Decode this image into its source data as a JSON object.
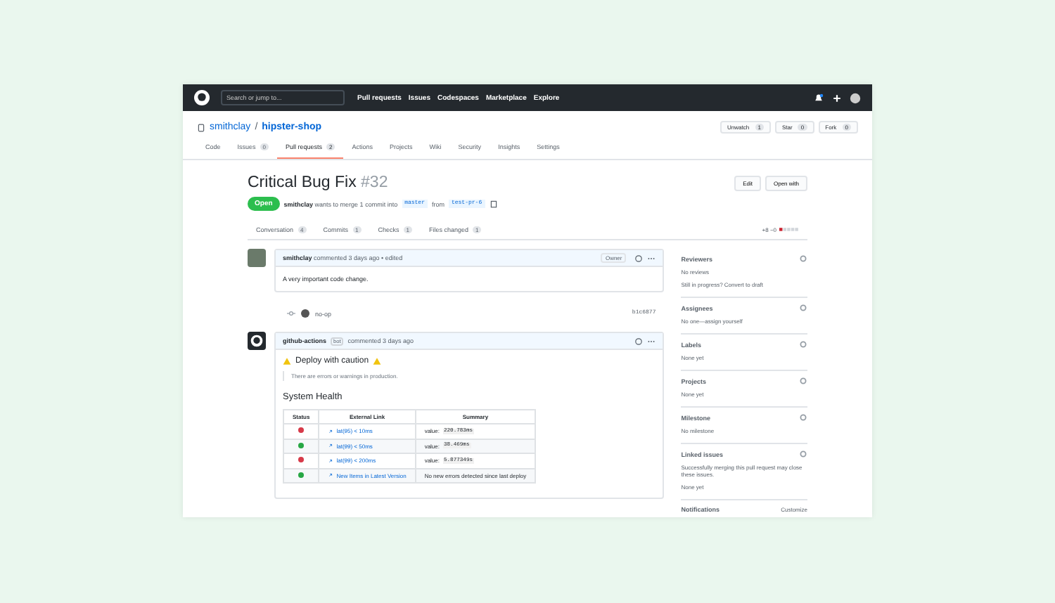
{
  "header": {
    "search": {
      "placeholder": "Search or jump to..."
    },
    "nav": [
      "Pull requests",
      "Issues",
      "Codespaces",
      "Marketplace",
      "Explore"
    ]
  },
  "repo": {
    "owner": "smithclay",
    "separator": "/",
    "name": "hipster-shop",
    "actions": [
      {
        "label": "Unwatch",
        "count": "1"
      },
      {
        "label": "Star",
        "count": "0"
      },
      {
        "label": "Fork",
        "count": "0"
      }
    ]
  },
  "tabs": [
    {
      "label": "Code",
      "selected": false
    },
    {
      "label": "Issues",
      "count": "0",
      "selected": false
    },
    {
      "label": "Pull requests",
      "count": "2",
      "selected": true
    },
    {
      "label": "Actions",
      "selected": false
    },
    {
      "label": "Projects",
      "selected": false
    },
    {
      "label": "Wiki",
      "selected": false
    },
    {
      "label": "Security",
      "selected": false
    },
    {
      "label": "Insights",
      "selected": false
    },
    {
      "label": "Settings",
      "selected": false
    }
  ],
  "pr": {
    "title": "Critical Bug Fix",
    "number": "#32",
    "buttons": [
      "Edit",
      "Open with"
    ],
    "state": "Open",
    "author": "smithclay",
    "merge_text": "wants to merge 1 commit into",
    "base": "master",
    "from": "from",
    "head": "test-pr-6",
    "tabs": [
      {
        "label": "Conversation",
        "count": "4"
      },
      {
        "label": "Commits",
        "count": "1"
      },
      {
        "label": "Checks",
        "count": "1"
      },
      {
        "label": "Files changed",
        "count": "1"
      }
    ],
    "diffstat": "+8 −0"
  },
  "comment": {
    "author": "smithclay",
    "meta": "commented 3 days ago • edited",
    "role": "Owner",
    "body": "A very important code change."
  },
  "commit": {
    "message": "no-op",
    "sha": "b1c6877"
  },
  "bot_comment": {
    "author": "github-actions",
    "badge": "bot",
    "meta": "commented 3 days ago",
    "heading": "Deploy with caution",
    "quote": "There are errors or warnings in production.",
    "table_title": "System Health",
    "columns": [
      "Status",
      "External Link",
      "Summary"
    ],
    "rows": [
      {
        "color": "#d73a49",
        "link": "lat(95) < 10ms",
        "summary_label": "value:",
        "summary_code": "220.783ms"
      },
      {
        "color": "#28a745",
        "link": "lat(99) < 50ms",
        "summary_label": "value:",
        "summary_code": "38.469ms"
      },
      {
        "color": "#d73a49",
        "link": "lat(99) < 200ms",
        "summary_label": "value:",
        "summary_code": "5.877349s"
      },
      {
        "color": "#28a745",
        "link": "New Items in Latest Version",
        "summary_label": "No new errors detected since last deploy"
      }
    ]
  },
  "sidebar": [
    {
      "title": "Reviewers",
      "lines": [
        "No reviews",
        "Still in progress? Convert to draft"
      ]
    },
    {
      "title": "Assignees",
      "lines": [
        "No one—assign yourself"
      ]
    },
    {
      "title": "Labels",
      "lines": [
        "None yet"
      ]
    },
    {
      "title": "Projects",
      "lines": [
        "None yet"
      ]
    },
    {
      "title": "Milestone",
      "lines": [
        "No milestone"
      ]
    },
    {
      "title": "Linked issues",
      "lines": [
        "Successfully merging this pull request may close these issues.",
        "None yet"
      ]
    },
    {
      "title": "Notifications",
      "action": "Customize"
    }
  ]
}
